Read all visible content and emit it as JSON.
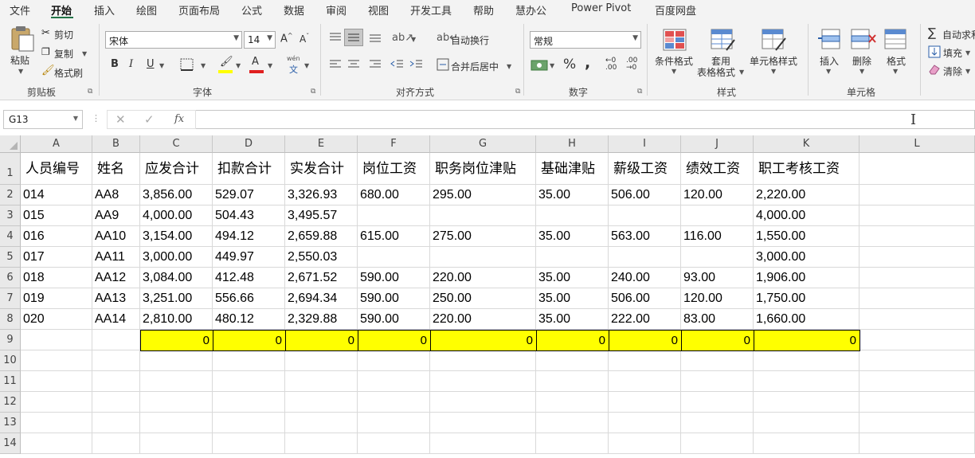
{
  "menu": {
    "tabs": [
      "文件",
      "开始",
      "插入",
      "绘图",
      "页面布局",
      "公式",
      "数据",
      "审阅",
      "视图",
      "开发工具",
      "帮助",
      "慧办公",
      "Power Pivot",
      "百度网盘"
    ]
  },
  "ribbon": {
    "clipboard": {
      "paste": "粘贴",
      "cut": "剪切",
      "copy": "复制",
      "format_painter": "格式刷",
      "label": "剪贴板"
    },
    "font": {
      "font_name": "宋体",
      "font_size": "14",
      "bold": "B",
      "italic": "I",
      "underline": "U",
      "phonetic": "wén",
      "label": "字体"
    },
    "alignment": {
      "wrap_text": "自动换行",
      "merge_center": "合并后居中",
      "label": "对齐方式"
    },
    "number": {
      "format": "常规",
      "percent": "%",
      "comma": ",",
      "label": "数字"
    },
    "styles": {
      "conditional": "条件格式",
      "table_format_1": "套用",
      "table_format_2": "表格格式",
      "cell_styles": "单元格样式",
      "label": "样式"
    },
    "cells": {
      "insert": "插入",
      "delete": "删除",
      "format": "格式",
      "label": "单元格"
    },
    "editing": {
      "autosum": "自动求和",
      "fill": "填充",
      "clear": "清除"
    }
  },
  "formula_bar": {
    "name_box": "G13",
    "fx": "fx",
    "formula": ""
  },
  "sheet": {
    "columns": [
      "A",
      "B",
      "C",
      "D",
      "E",
      "F",
      "G",
      "H",
      "I",
      "J",
      "K",
      "L"
    ],
    "rows": [
      "1",
      "2",
      "3",
      "4",
      "5",
      "6",
      "7",
      "8",
      "9",
      "10",
      "11",
      "12",
      "13",
      "14"
    ],
    "header": [
      "人员编号",
      "姓名",
      "应发合计",
      "扣款合计",
      "实发合计",
      "岗位工资",
      "职务岗位津贴",
      "基础津贴",
      "薪级工资",
      "绩效工资",
      "职工考核工资"
    ],
    "data": [
      [
        "014",
        "AA8",
        "3,856.00",
        "529.07",
        "3,326.93",
        "680.00",
        "295.00",
        "35.00",
        "506.00",
        "120.00",
        "2,220.00"
      ],
      [
        "015",
        "AA9",
        "4,000.00",
        "504.43",
        "3,495.57",
        "",
        "",
        "",
        "",
        "",
        "4,000.00"
      ],
      [
        "016",
        "AA10",
        "3,154.00",
        "494.12",
        "2,659.88",
        "615.00",
        "275.00",
        "35.00",
        "563.00",
        "116.00",
        "1,550.00"
      ],
      [
        "017",
        "AA11",
        "3,000.00",
        "449.97",
        "2,550.03",
        "",
        "",
        "",
        "",
        "",
        "3,000.00"
      ],
      [
        "018",
        "AA12",
        "3,084.00",
        "412.48",
        "2,671.52",
        "590.00",
        "220.00",
        "35.00",
        "240.00",
        "93.00",
        "1,906.00"
      ],
      [
        "019",
        "AA13",
        "3,251.00",
        "556.66",
        "2,694.34",
        "590.00",
        "250.00",
        "35.00",
        "506.00",
        "120.00",
        "1,750.00"
      ],
      [
        "020",
        "AA14",
        "2,810.00",
        "480.12",
        "2,329.88",
        "590.00",
        "220.00",
        "35.00",
        "222.00",
        "83.00",
        "1,660.00"
      ]
    ],
    "totals": [
      "0",
      "0",
      "0",
      "0",
      "0",
      "0",
      "0",
      "0",
      "0"
    ],
    "total_fill_color": "#ffff00"
  }
}
